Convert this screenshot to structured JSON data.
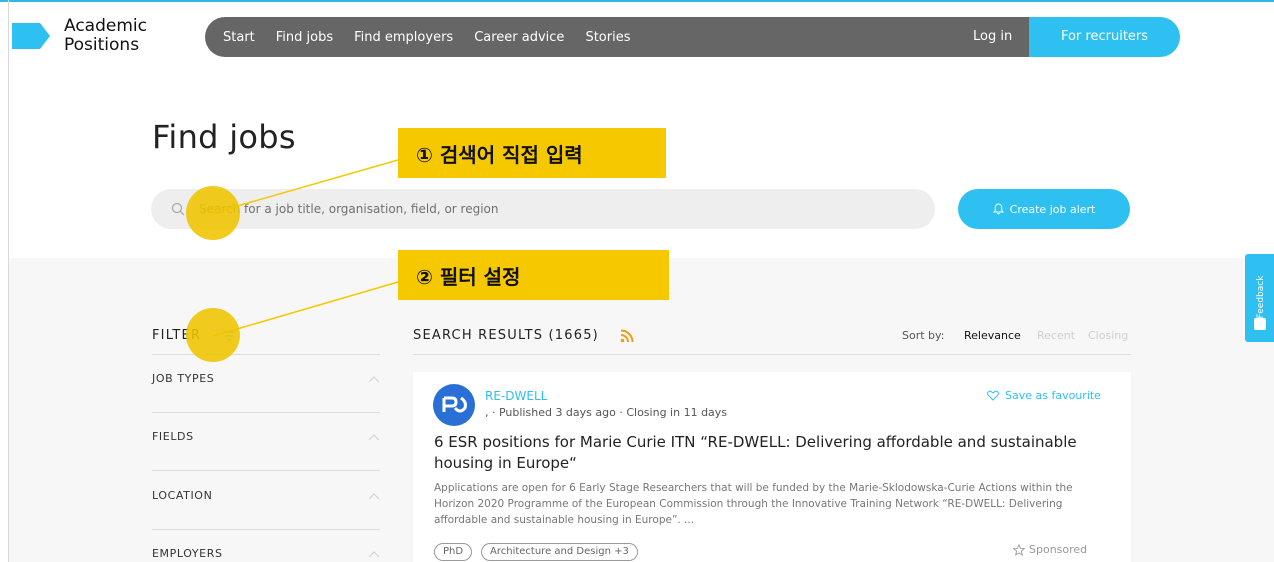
{
  "brand": {
    "logo_line1": "Academic",
    "logo_line2": "Positions",
    "accent_color": "#2ec0f1"
  },
  "nav": {
    "items": [
      "Start",
      "Find jobs",
      "Find employers",
      "Career advice",
      "Stories"
    ],
    "login": "Log in",
    "recruiters": "For recruiters"
  },
  "page": {
    "title": "Find jobs"
  },
  "search": {
    "placeholder": "Search for a job title, organisation, field, or region",
    "icon": "search-icon"
  },
  "alert_button": {
    "label": "Create job alert",
    "icon": "bell-icon"
  },
  "annotations": {
    "step1": "① 검색어 직접 입력",
    "step2": "② 필터 설정",
    "color": "#f6c800"
  },
  "filter": {
    "title": "FILTER",
    "items": [
      "JOB TYPES",
      "FIELDS",
      "LOCATION",
      "EMPLOYERS"
    ]
  },
  "results": {
    "title": "SEARCH RESULTS (1665)",
    "sort_label": "Sort by:",
    "sort_options": [
      "Relevance",
      "Recent",
      "Closing"
    ],
    "sort_active": "Relevance"
  },
  "job": {
    "employer": "RE-DWELL",
    "meta": ", · Published 3 days ago · Closing in 11 days",
    "favourite": "Save as favourite",
    "title": "6 ESR positions for Marie Curie ITN “RE-DWELL: Delivering affordable and sustainable housing in Europe“",
    "description": "Applications are open for 6 Early Stage Researchers that will be funded by the Marie-Sklodowska-Curie Actions within the Horizon 2020 Programme of the European Commission through the Innovative Training Network “RE-DWELL: Delivering affordable and sustainable housing in Europe”. ...",
    "tags": [
      "PhD",
      "Architecture and Design +3"
    ],
    "sponsored": "Sponsored"
  },
  "feedback": {
    "label": "Feedback"
  }
}
